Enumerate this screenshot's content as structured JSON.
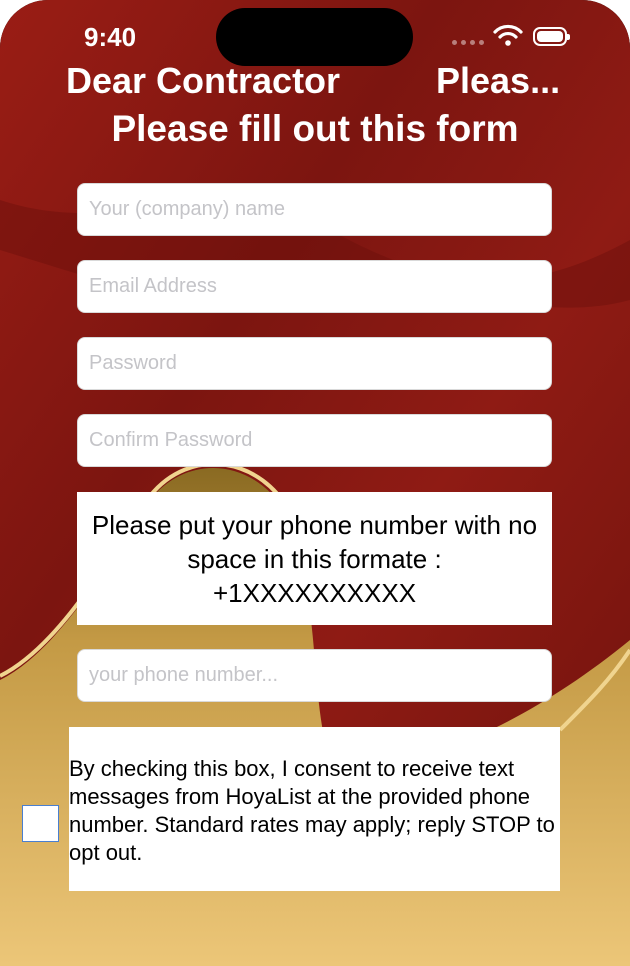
{
  "status_bar": {
    "time": "9:40"
  },
  "nav": {
    "title_left": "Dear Contractor",
    "title_right": "Pleas..."
  },
  "form": {
    "heading": "Please fill out this form",
    "name_placeholder": "Your (company) name",
    "email_placeholder": "Email Address",
    "password_placeholder": "Password",
    "confirm_password_placeholder": "Confirm Password",
    "phone_note": "Please put your phone number with no space in this formate : +1XXXXXXXXXX",
    "phone_placeholder": "your phone number...",
    "consent_text": "By checking this box, I consent to receive text messages from HoyaList at the provided phone number. Standard rates may apply; reply STOP to opt out."
  },
  "colors": {
    "primary_red": "#8e1a14",
    "gold": "#e8c172",
    "checkbox_border": "#4a7fd0"
  }
}
